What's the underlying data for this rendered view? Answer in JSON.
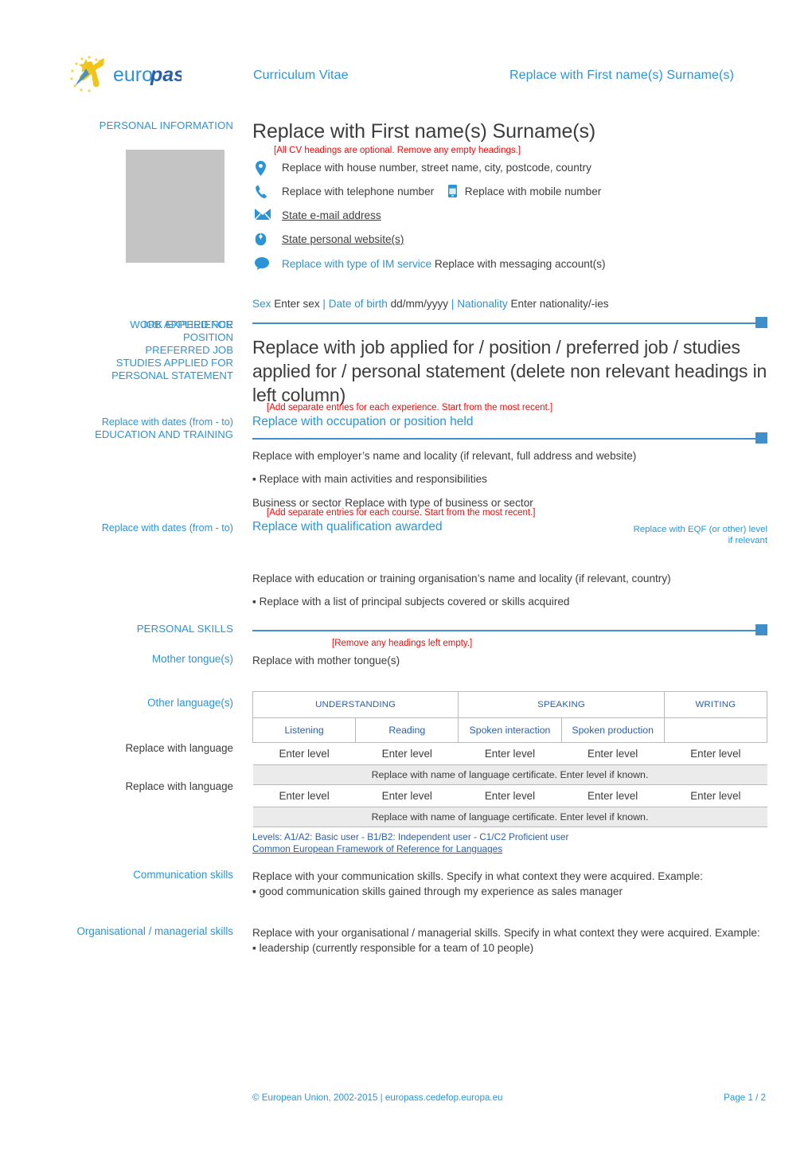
{
  "header": {
    "logo_text": "europass",
    "document_type": "Curriculum Vitae",
    "name_header": "Replace with First name(s) Surname(s)"
  },
  "personal_information": {
    "section_label": "PERSONAL INFORMATION",
    "full_name": "Replace with First name(s) Surname(s)",
    "headings_note": "[All CV headings are optional. Remove any empty headings.]",
    "address": "Replace with house number, street name, city, postcode, country",
    "telephone": "Replace with telephone number",
    "mobile": "Replace with mobile number",
    "email": "State e-mail address",
    "website": "State personal website(s)",
    "im_service": "Replace with type of IM service",
    "im_account": "Replace with messaging account(s)",
    "sex_label": "Sex",
    "sex_value": "Enter sex",
    "dob_label": "Date of birth",
    "dob_value": "dd/mm/yyyy",
    "nationality_label": "Nationality",
    "nationality_value": "Enter nationality/-ies",
    "separator": "|",
    "icons": {
      "address": "location-pin-icon",
      "telephone": "phone-icon",
      "mobile": "mobile-phone-icon",
      "email": "envelope-icon",
      "website": "globe-mouse-icon",
      "im": "chat-bubble-icon"
    }
  },
  "job_applied": {
    "labels_overlapped": [
      "WORK EXPERIENCE",
      "JOB APPLIED FOR"
    ],
    "labels_stack": [
      "POSITION",
      "PREFERRED JOB",
      "STUDIES APPLIED FOR",
      "PERSONAL STATEMENT"
    ],
    "heading": "Replace with job applied for / position / preferred job / studies applied for / personal statement (delete non relevant headings in left column)"
  },
  "work_experience": {
    "note": "[Add separate entries for each experience. Start from the most recent.]",
    "dates_label": "Replace with dates (from - to)",
    "education_label": "EDUCATION AND TRAINING",
    "occupation": "Replace with occupation or position held",
    "employer": "Replace with employer’s name and locality (if relevant, full address and website)",
    "activities": "▪ Replace with main activities and responsibilities",
    "business_sector_label": "Business or sector",
    "business_sector_value": "Replace with type of business or sector"
  },
  "education": {
    "note": "[Add separate entries for each course. Start from the most recent.]",
    "dates_label": "Replace with dates (from - to)",
    "qualification": "Replace with qualification awarded",
    "eqf_note": "Replace with EQF (or other) level if relevant",
    "organisation": "Replace with education or training organisation’s name and locality (if relevant, country)",
    "subjects": "▪ Replace with a list of principal subjects covered or skills acquired"
  },
  "personal_skills": {
    "section_label": "PERSONAL SKILLS",
    "note": "[Remove any headings left empty.]",
    "mother_tongue_label": "Mother tongue(s)",
    "mother_tongue_value": "Replace with mother tongue(s)",
    "other_languages_label": "Other language(s)"
  },
  "language_table": {
    "group_headers": [
      "UNDERSTANDING",
      "SPEAKING",
      "WRITING"
    ],
    "sub_headers": [
      "Listening",
      "Reading",
      "Spoken interaction",
      "Spoken production"
    ],
    "rows": [
      {
        "language": "Replace with language",
        "levels": [
          "Enter level",
          "Enter level",
          "Enter level",
          "Enter level",
          "Enter level"
        ],
        "certificate": "Replace with name of language certificate. Enter level if known."
      },
      {
        "language": "Replace with language",
        "levels": [
          "Enter level",
          "Enter level",
          "Enter level",
          "Enter level",
          "Enter level"
        ],
        "certificate": "Replace with name of language certificate. Enter level if known."
      }
    ],
    "levels_legend": "Levels: A1/A2: Basic user - B1/B2: Independent user - C1/C2 Proficient user",
    "framework_link": "Common European Framework of Reference for Languages"
  },
  "communication": {
    "label": "Communication skills",
    "text": "Replace with your communication skills. Specify in what context they were acquired. Example:",
    "bullet": "▪ good communication skills gained through my experience as sales manager"
  },
  "organisational": {
    "label": "Organisational / managerial skills",
    "text": "Replace with your organisational / managerial skills. Specify in what context they were acquired. Example:",
    "bullet": "▪ leadership (currently responsible for a team of 10 people)"
  },
  "footer": {
    "copyright": "© European Union, 2002-2015 | europass.cedefop.europa.eu",
    "page": "Page 1 / 2"
  },
  "colors": {
    "europass_blue": "#2a94d6",
    "divider_blue": "#3f8fcc",
    "red_note": "#ff0000",
    "table_blue": "#2a5fa8",
    "photo_grey": "#c4c4c4"
  }
}
